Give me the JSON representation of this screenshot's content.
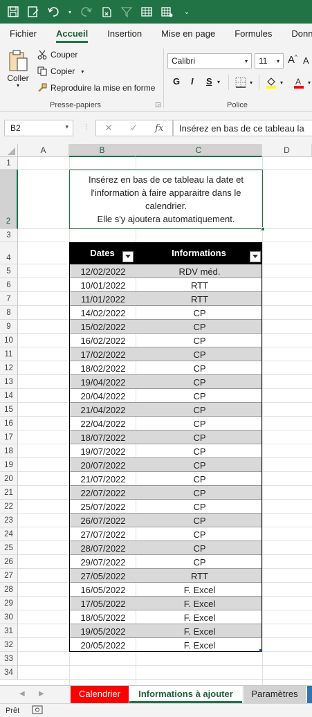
{
  "ribbon": {
    "tabs": [
      "Fichier",
      "Accueil",
      "Insertion",
      "Mise en page",
      "Formules",
      "Donn"
    ],
    "clipboard": {
      "paste": "Coller",
      "cut": "Couper",
      "copy": "Copier",
      "format_painter": "Reproduire la mise en forme",
      "group": "Presse-papiers"
    },
    "font": {
      "name": "Calibri",
      "size": "11",
      "bold": "G",
      "italic": "I",
      "group": "Police"
    }
  },
  "formula_bar": {
    "cell_ref": "B2",
    "fx": "fx",
    "content": "Insérez en bas de ce tableau la"
  },
  "columns": [
    "A",
    "B",
    "C",
    "D"
  ],
  "rows": [
    "1",
    "2",
    "3",
    "4",
    "5",
    "6",
    "7",
    "8",
    "9",
    "10",
    "11",
    "12",
    "13",
    "14",
    "15",
    "16",
    "17",
    "18",
    "19",
    "20",
    "21",
    "22",
    "23",
    "24",
    "25",
    "26",
    "27",
    "28",
    "29",
    "30",
    "31",
    "32",
    "33",
    "34"
  ],
  "note": {
    "line1": "Insérez en bas de ce tableau la date et",
    "line2": "l'information à faire apparaitre dans le",
    "line3": "calendrier.",
    "line4": "Elle s'y ajoutera automatiquement."
  },
  "table": {
    "headers": [
      "Dates",
      "Informations"
    ],
    "rows": [
      [
        "12/02/2022",
        "RDV méd."
      ],
      [
        "10/01/2022",
        "RTT"
      ],
      [
        "11/01/2022",
        "RTT"
      ],
      [
        "14/02/2022",
        "CP"
      ],
      [
        "15/02/2022",
        "CP"
      ],
      [
        "16/02/2022",
        "CP"
      ],
      [
        "17/02/2022",
        "CP"
      ],
      [
        "18/02/2022",
        "CP"
      ],
      [
        "19/04/2022",
        "CP"
      ],
      [
        "20/04/2022",
        "CP"
      ],
      [
        "21/04/2022",
        "CP"
      ],
      [
        "22/04/2022",
        "CP"
      ],
      [
        "18/07/2022",
        "CP"
      ],
      [
        "19/07/2022",
        "CP"
      ],
      [
        "20/07/2022",
        "CP"
      ],
      [
        "21/07/2022",
        "CP"
      ],
      [
        "22/07/2022",
        "CP"
      ],
      [
        "25/07/2022",
        "CP"
      ],
      [
        "26/07/2022",
        "CP"
      ],
      [
        "27/07/2022",
        "CP"
      ],
      [
        "28/07/2022",
        "CP"
      ],
      [
        "29/07/2022",
        "CP"
      ],
      [
        "27/05/2022",
        "RTT"
      ],
      [
        "16/05/2022",
        "F. Excel"
      ],
      [
        "17/05/2022",
        "F. Excel"
      ],
      [
        "18/05/2022",
        "F. Excel"
      ],
      [
        "19/05/2022",
        "F. Excel"
      ],
      [
        "20/05/2022",
        "F. Excel"
      ]
    ]
  },
  "sheets": [
    "Calendrier",
    "Informations à ajouter",
    "Paramètres"
  ],
  "status": "Prêt",
  "colors": {
    "excel_green": "#217346",
    "sheet_calendrier": "#ff0000",
    "table_header": "#000000",
    "band": "#d9d9d9"
  }
}
